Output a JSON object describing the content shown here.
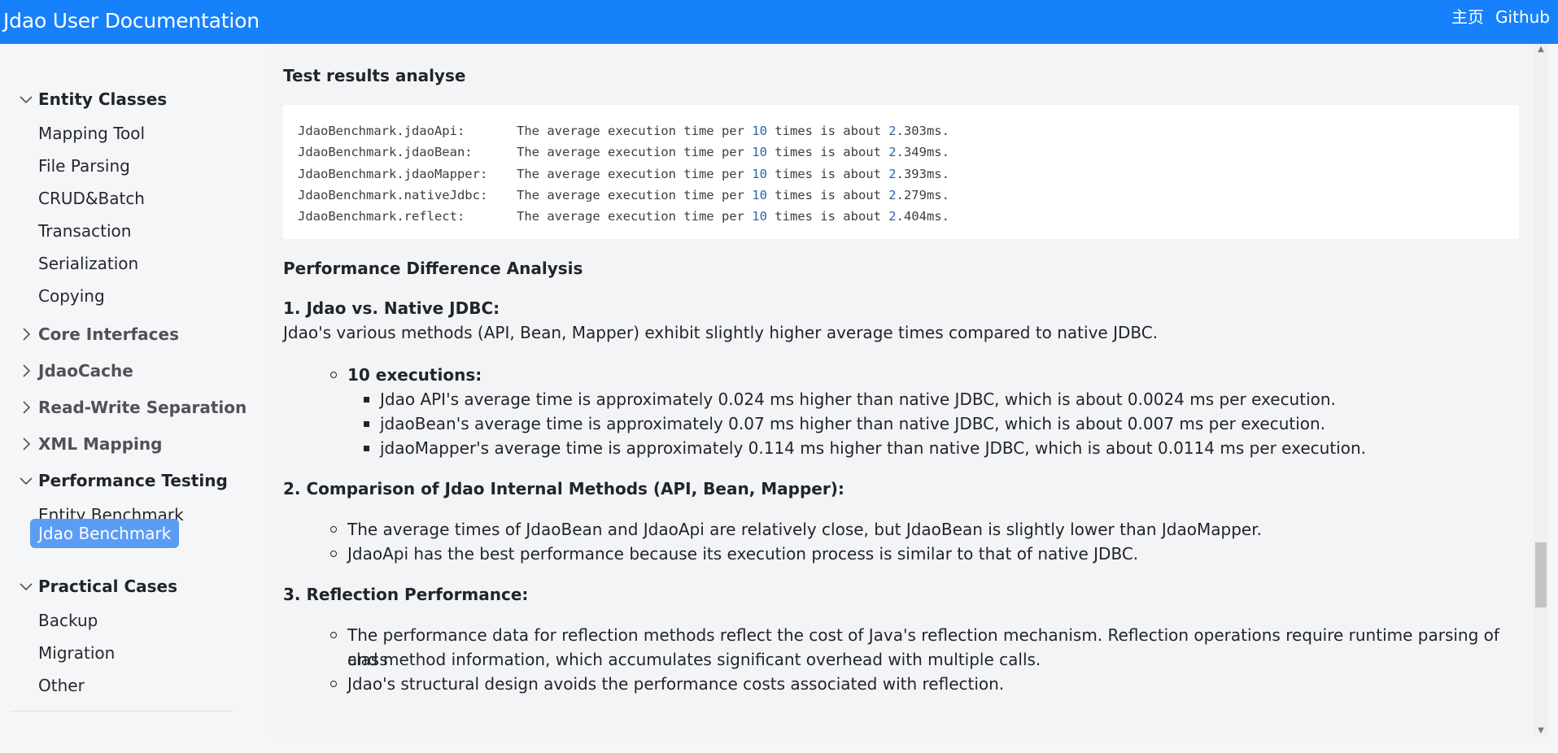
{
  "header": {
    "title": "Jdao User Documentation",
    "nav": [
      "主页",
      "Github"
    ],
    "bg_color": "#1780fb"
  },
  "sidebar": {
    "groups": [
      {
        "label": "Entity Classes",
        "expanded": true,
        "items": [
          "Mapping Tool",
          "File Parsing",
          "CRUD&Batch",
          "Transaction",
          "Serialization",
          "Copying"
        ]
      },
      {
        "label": "Core Interfaces",
        "expanded": false
      },
      {
        "label": "JdaoCache",
        "expanded": false
      },
      {
        "label": "Read-Write Separation",
        "expanded": false
      },
      {
        "label": "XML Mapping",
        "expanded": false
      },
      {
        "label": "Performance Testing",
        "expanded": true,
        "items": [
          "Entity Benchmark",
          "Jdao Benchmark"
        ]
      },
      {
        "label": "Practical Cases",
        "expanded": true,
        "items": [
          "Backup",
          "Migration",
          "Other"
        ]
      }
    ],
    "active_item": "Jdao Benchmark",
    "active_color": "#5b9cf5"
  },
  "content": {
    "test_results_heading": "Test results analyse",
    "code_lines": [
      {
        "method": "JdaoBenchmark.jdaoApi:",
        "text_a": "The average execution time per ",
        "count": "10",
        "text_b": " times is about ",
        "lead": "2",
        "rest": ".303ms."
      },
      {
        "method": "JdaoBenchmark.jdaoBean:",
        "text_a": "The average execution time per ",
        "count": "10",
        "text_b": " times is about ",
        "lead": "2",
        "rest": ".349ms."
      },
      {
        "method": "JdaoBenchmark.jdaoMapper:",
        "text_a": "The average execution time per ",
        "count": "10",
        "text_b": " times is about ",
        "lead": "2",
        "rest": ".393ms."
      },
      {
        "method": "JdaoBenchmark.nativeJdbc:",
        "text_a": "The average execution time per ",
        "count": "10",
        "text_b": " times is about ",
        "lead": "2",
        "rest": ".279ms."
      },
      {
        "method": "JdaoBenchmark.reflect:",
        "text_a": "The average execution time per ",
        "count": "10",
        "text_b": " times is about ",
        "lead": "2",
        "rest": ".404ms."
      }
    ],
    "perf_heading": "Performance Difference Analysis",
    "section1": {
      "title": "1. Jdao vs. Native JDBC:",
      "intro": "Jdao's various methods (API, Bean, Mapper) exhibit slightly higher average times compared to native JDBC.",
      "sub_title": "10 executions:",
      "sub_items": [
        "Jdao API's average time is approximately 0.024 ms higher than native JDBC, which is about 0.0024 ms per execution.",
        "jdaoBean's average time is approximately 0.07 ms higher than native JDBC, which is about 0.007 ms per execution.",
        "jdaoMapper's average time is approximately 0.114 ms higher than native JDBC, which is about 0.0114 ms per execution."
      ]
    },
    "section2": {
      "title": "2. Comparison of Jdao Internal Methods (API, Bean, Mapper):",
      "items": [
        "The average times of JdaoBean and JdaoApi are relatively close, but JdaoBean is slightly lower than JdaoMapper.",
        "JdaoApi has the best performance because its execution process is similar to that of native JDBC."
      ]
    },
    "section3": {
      "title": "3. Reflection Performance:",
      "item1_line1": "The performance data for reflection methods reflect the cost of Java's reflection mechanism. Reflection operations require runtime parsing of class",
      "item1_line2": "and method information, which accumulates significant overhead with multiple calls.",
      "item2": "Jdao's structural design avoids the performance costs associated with reflection."
    }
  }
}
